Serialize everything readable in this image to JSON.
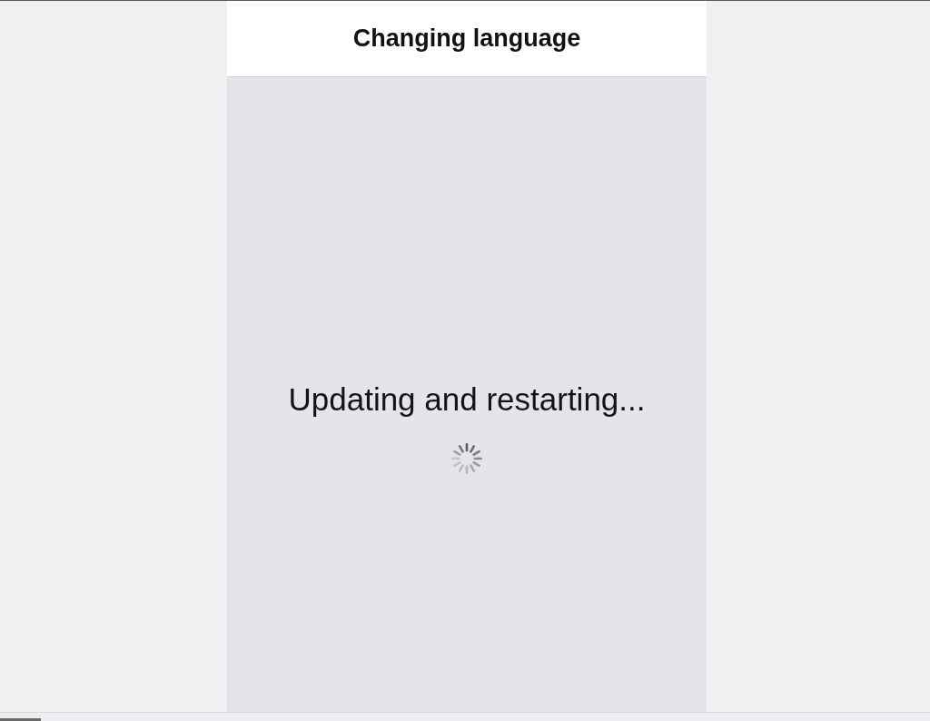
{
  "header": {
    "title": "Changing language"
  },
  "content": {
    "message": "Updating and restarting..."
  }
}
